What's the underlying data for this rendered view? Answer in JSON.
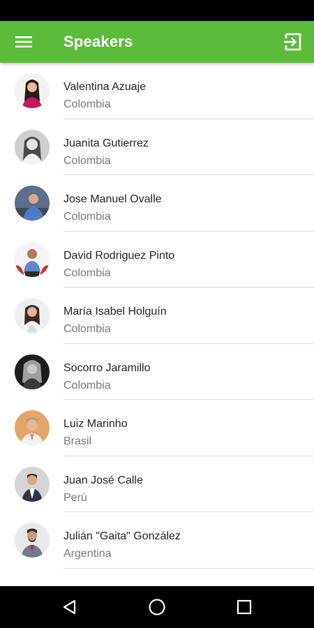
{
  "app_bar": {
    "title": "Speakers",
    "background": "#5cbb3b",
    "menu_icon": "hamburger-menu-icon",
    "logout_icon": "exit-to-app-icon"
  },
  "speakers": [
    {
      "name": "Valentina Azuaje",
      "country": "Colombia"
    },
    {
      "name": "Juanita Gutierrez",
      "country": "Colombia"
    },
    {
      "name": "Jose Manuel Ovalle",
      "country": "Colombia"
    },
    {
      "name": "David Rodriguez Pinto",
      "country": "Colombia"
    },
    {
      "name": "María Isabel Holguín",
      "country": "Colombia"
    },
    {
      "name": "Socorro Jaramillo",
      "country": "Colombia"
    },
    {
      "name": "Luiz Marinho",
      "country": "Brasil"
    },
    {
      "name": "Juan José Calle",
      "country": "Perú"
    },
    {
      "name": "Julián \"Gaita\" González",
      "country": "Argentina"
    }
  ],
  "nav_bar": {
    "back_icon": "back-triangle-icon",
    "home_icon": "home-circle-icon",
    "recents_icon": "recents-square-icon"
  }
}
